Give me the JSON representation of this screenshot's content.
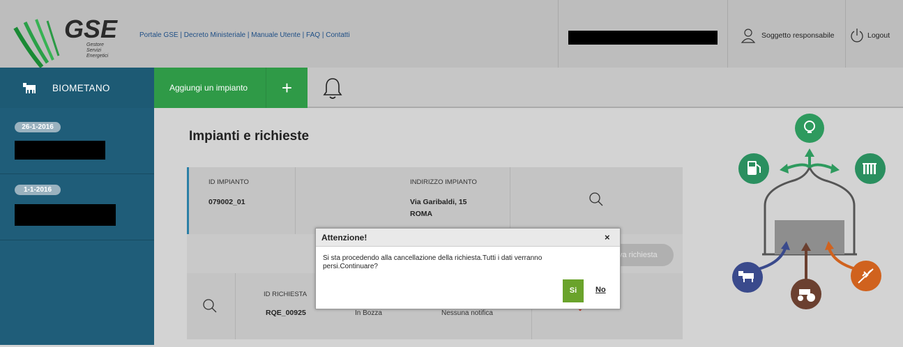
{
  "logo": {
    "brand": "GSE",
    "sub1": "Gestore",
    "sub2": "Servizi",
    "sub3": "Energetici"
  },
  "toplinks": [
    "Portale GSE",
    "Decreto Ministeriale",
    "Manuale Utente",
    "FAQ",
    "Contatti"
  ],
  "header": {
    "user_label": "Soggetto responsabile",
    "logout_label": "Logout"
  },
  "nav": {
    "section": "BIOMETANO",
    "add_label": "Aggiungi un impianto",
    "plus": "+"
  },
  "sidebar": {
    "items": [
      {
        "date": "26-1-2016"
      },
      {
        "date": "1-1-2016"
      }
    ]
  },
  "main": {
    "title": "Impianti e richieste",
    "plant": {
      "id_label": "ID IMPIANTO",
      "id_value": "079002_01",
      "addr_label": "INDIRIZZO IMPIANTO",
      "addr_line1": "Via Garibaldi, 15",
      "addr_line2": "ROMA"
    },
    "new_request_label": "va richiesta",
    "request": {
      "id_label": "ID RICHIESTA",
      "id_value": "RQE_00925",
      "status": "In Bozza",
      "notification": "Nessuna notifica"
    }
  },
  "dialog": {
    "title": "Attenzione!",
    "close": "×",
    "message": "Si sta procedendo alla cancellazione della richiesta.Tutti i dati verranno persi.Continuare?",
    "yes": "Si",
    "no": "No"
  },
  "colors": {
    "sidebar": "#1f5d79",
    "accent_green": "#2f9a47",
    "bulb": "#2e9a5e",
    "fuel": "#2a8f5f",
    "radiator": "#2a8f5f",
    "cow": "#3a4a8c",
    "tractor": "#6b4030",
    "wheat": "#d0621e",
    "tank": "#5b5b5b"
  }
}
